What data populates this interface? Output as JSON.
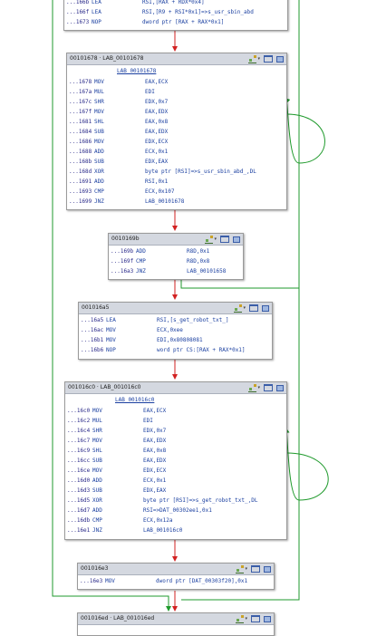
{
  "colors": {
    "edge_true": "#1f9a2c",
    "edge_false": "#d22020",
    "edge_flow": "#d22020",
    "header_bg": "#d4d8e0",
    "mnemonic": "#1a3fa0"
  },
  "header_icons": [
    "graph-icon",
    "window-icon",
    "grid-icon"
  ],
  "blocks": {
    "top": {
      "title": "",
      "rows": [
        {
          "addr": "...166b",
          "mn": "LEA",
          "ops": "RSI,[RAX + RDX*0x4]"
        },
        {
          "addr": "...166f",
          "mn": "LEA",
          "ops": "RSI,[R9 + RSI*0x1]=>s_usr_sbin_abd"
        },
        {
          "addr": "...1673",
          "mn": "NOP",
          "ops": "dword ptr [RAX + RAX*0x1]"
        }
      ]
    },
    "b1678": {
      "title": "00101678 · LAB_00101678",
      "label": "LAB_00101678",
      "rows": [
        {
          "addr": "...1678",
          "mn": "MOV",
          "ops": "EAX,ECX"
        },
        {
          "addr": "...167a",
          "mn": "MUL",
          "ops": "EDI"
        },
        {
          "addr": "...167c",
          "mn": "SHR",
          "ops": "EDX,0x7"
        },
        {
          "addr": "...167f",
          "mn": "MOV",
          "ops": "EAX,EDX"
        },
        {
          "addr": "...1681",
          "mn": "SHL",
          "ops": "EAX,0x8"
        },
        {
          "addr": "...1684",
          "mn": "SUB",
          "ops": "EAX,EDX"
        },
        {
          "addr": "...1686",
          "mn": "MOV",
          "ops": "EDX,ECX"
        },
        {
          "addr": "...1688",
          "mn": "ADD",
          "ops": "ECX,0x1"
        },
        {
          "addr": "...168b",
          "mn": "SUB",
          "ops": "EDX,EAX"
        },
        {
          "addr": "...168d",
          "mn": "XOR",
          "ops": "byte ptr [RSI]=>s_usr_sbin_abd_,DL"
        },
        {
          "addr": "...1691",
          "mn": "ADD",
          "ops": "RSI,0x1"
        },
        {
          "addr": "...1693",
          "mn": "CMP",
          "ops": "ECX,0x107"
        },
        {
          "addr": "...1699",
          "mn": "JNZ",
          "ops": "LAB_00101678"
        }
      ]
    },
    "b169b": {
      "title": "0010169b",
      "rows": [
        {
          "addr": "...169b",
          "mn": "ADD",
          "ops": "R8D,0x1"
        },
        {
          "addr": "...169f",
          "mn": "CMP",
          "ops": "R8D,0x8"
        },
        {
          "addr": "...16a3",
          "mn": "JNZ",
          "ops": "LAB_00101658"
        }
      ]
    },
    "b16a5": {
      "title": "001016a5",
      "rows": [
        {
          "addr": "...16a5",
          "mn": "LEA",
          "ops": "RSI,[s_get_robot_txt_]"
        },
        {
          "addr": "...16ac",
          "mn": "MOV",
          "ops": "ECX,0xee"
        },
        {
          "addr": "...16b1",
          "mn": "MOV",
          "ops": "EDI,0x80808081"
        },
        {
          "addr": "...16b6",
          "mn": "NOP",
          "ops": "word ptr CS:[RAX + RAX*0x1]"
        }
      ]
    },
    "b16c0": {
      "title": "001016c0 · LAB_001016c0",
      "label": "LAB_001016c0",
      "rows": [
        {
          "addr": "...16c0",
          "mn": "MOV",
          "ops": "EAX,ECX"
        },
        {
          "addr": "...16c2",
          "mn": "MUL",
          "ops": "EDI"
        },
        {
          "addr": "...16c4",
          "mn": "SHR",
          "ops": "EDX,0x7"
        },
        {
          "addr": "...16c7",
          "mn": "MOV",
          "ops": "EAX,EDX"
        },
        {
          "addr": "...16c9",
          "mn": "SHL",
          "ops": "EAX,0x8"
        },
        {
          "addr": "...16cc",
          "mn": "SUB",
          "ops": "EAX,EDX"
        },
        {
          "addr": "...16ce",
          "mn": "MOV",
          "ops": "EDX,ECX"
        },
        {
          "addr": "...16d0",
          "mn": "ADD",
          "ops": "ECX,0x1"
        },
        {
          "addr": "...16d3",
          "mn": "SUB",
          "ops": "EDX,EAX"
        },
        {
          "addr": "...16d5",
          "mn": "XOR",
          "ops": "byte ptr [RSI]=>s_get_robot_txt_,DL"
        },
        {
          "addr": "...16d7",
          "mn": "ADD",
          "ops": "RSI=>DAT_00302ee1,0x1"
        },
        {
          "addr": "...16db",
          "mn": "CMP",
          "ops": "ECX,0x12a"
        },
        {
          "addr": "...16e1",
          "mn": "JNZ",
          "ops": "LAB_001016c0"
        }
      ]
    },
    "b16e3": {
      "title": "001016e3",
      "rows": [
        {
          "addr": "...16e3",
          "mn": "MOV",
          "ops": "dword ptr [DAT_00303f20],0x1"
        }
      ]
    },
    "b16ed": {
      "title": "001016ed · LAB_001016ed",
      "rows": []
    }
  }
}
